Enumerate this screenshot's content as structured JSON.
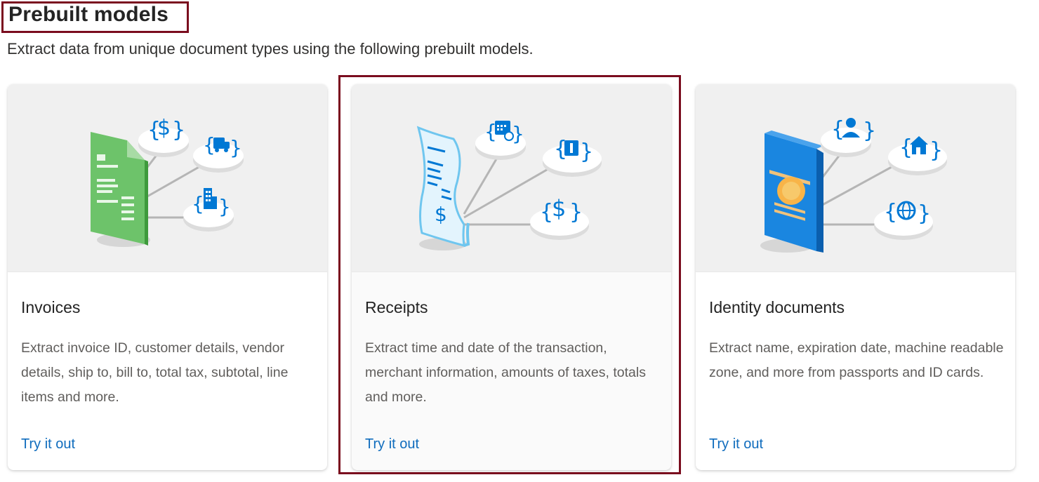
{
  "header": {
    "title": "Prebuilt models",
    "subtitle": "Extract data from unique document types using the following prebuilt models."
  },
  "cards": [
    {
      "title": "Invoices",
      "description": "Extract invoice ID, customer details, vendor details, ship to, bill to, total tax, subtotal, line items and more.",
      "link": "Try it out",
      "illustration": "invoice-illustration"
    },
    {
      "title": "Receipts",
      "description": "Extract time and date of the transaction, merchant information, amounts of taxes, totals and more.",
      "link": "Try it out",
      "illustration": "receipt-illustration"
    },
    {
      "title": "Identity documents",
      "description": "Extract name, expiration date, machine readable zone, and more from passports and ID cards.",
      "link": "Try it out",
      "illustration": "passport-illustration"
    }
  ],
  "colors": {
    "accent_link": "#0f6cbd",
    "highlight_border": "#7a0c1e",
    "icon_blue": "#0078d4",
    "invoice_green": "#5db85b"
  }
}
